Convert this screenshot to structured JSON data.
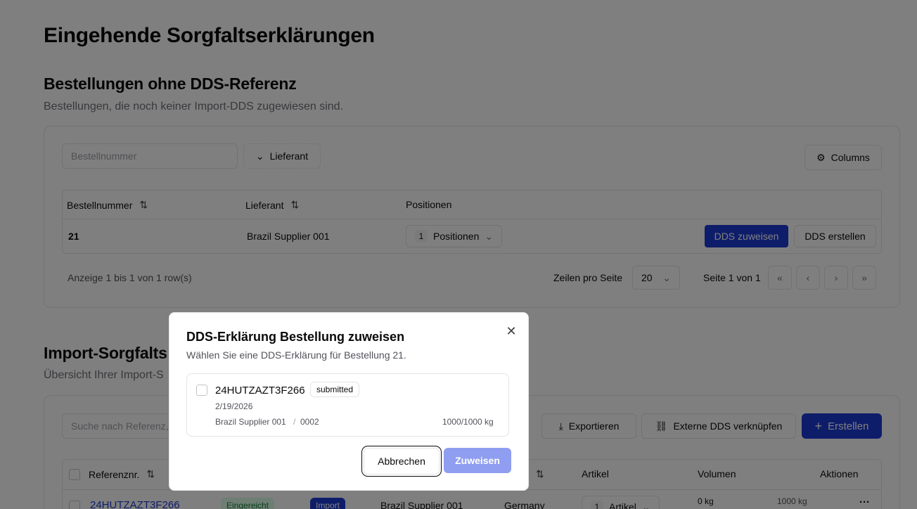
{
  "page": {
    "title": "Eingehende Sorgfaltserklärungen"
  },
  "orders_section": {
    "title": "Bestellungen ohne DDS-Referenz",
    "description": "Bestellungen, die noch keiner Import-DDS zugewiesen sind.",
    "search_placeholder": "Bestellnummer",
    "supplier_filter_label": "Lieferant",
    "columns_button_label": "Columns",
    "columns": [
      "Bestellnummer",
      "Lieferant",
      "Positionen"
    ],
    "rows": [
      {
        "order_number": "21",
        "supplier": "Brazil Supplier 001",
        "positions_count": "1",
        "positions_label": "Positionen",
        "assign_label": "DDS zuweisen",
        "create_label": "DDS erstellen"
      }
    ],
    "footer": {
      "showing": "Anzeige 1 bis 1 von 1 row(s)",
      "rows_per_page_label": "Zeilen pro Seite",
      "rows_per_page_value": "20",
      "page_info": "Seite 1 von 1"
    }
  },
  "imports_section": {
    "title": "Import-Sorgfalts",
    "description": "Übersicht Ihrer Import-S",
    "search_placeholder": "Suche nach Referenz,",
    "export_label": "Exportieren",
    "link_external_label": "Externe DDS verknüpfen",
    "create_label": "Erstellen",
    "columns": [
      "Referenznr.",
      "Artikel",
      "Volumen",
      "Aktionen"
    ],
    "rows": [
      {
        "reference": "24HUTZAZT3F266",
        "status": "Eingereicht",
        "type": "Import",
        "supplier": "Brazil Supplier 001",
        "country": "Germany",
        "article_count": "1",
        "article_label": "Artikel",
        "volume_a": "0 kg",
        "volume_b": "1000 kg",
        "actions_label": "···"
      }
    ]
  },
  "dialog": {
    "title": "DDS-Erklärung Bestellung zuweisen",
    "description": "Wählen Sie eine DDS-Erklärung für Bestellung 21.",
    "option": {
      "reference": "24HUTZAZT3F266",
      "status": "submitted",
      "date": "2/19/2026",
      "supplier": "Brazil Supplier 001",
      "separator": "/",
      "code": "0002",
      "quantity": "1000/1000 kg"
    },
    "cancel_label": "Abbrechen",
    "assign_label": "Zuweisen"
  },
  "colors": {
    "primary": "#1d3bd4",
    "primary_disabled": "#8f9ef0",
    "link": "#1d3bd4",
    "badge_green_bg": "#dcfce7",
    "badge_green_text": "#15803d"
  }
}
